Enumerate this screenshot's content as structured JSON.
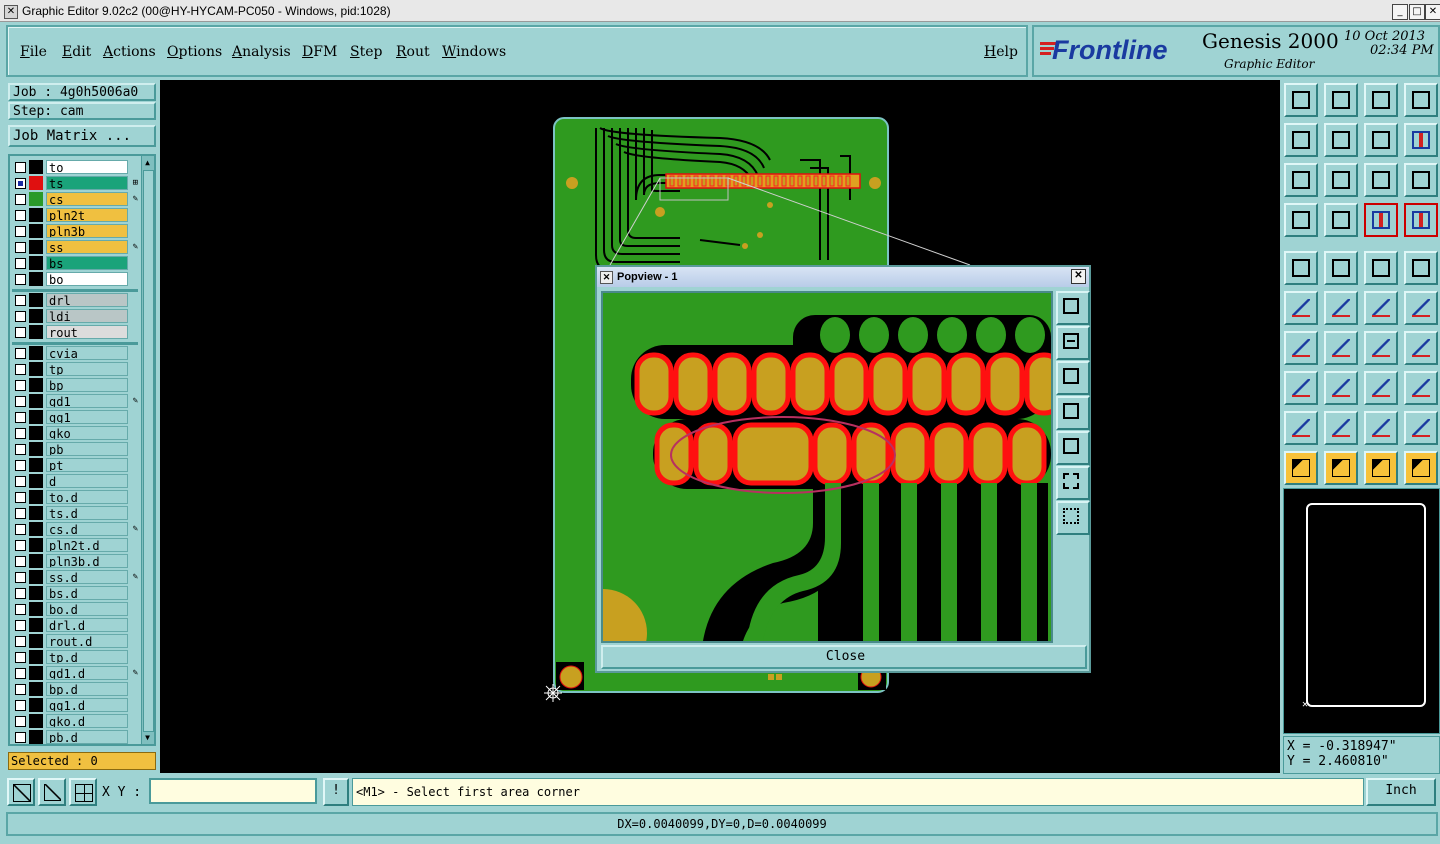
{
  "window": {
    "title": "Graphic Editor 9.02c2 (00@HY-HYCAM-PC050 - Windows, pid:1028)",
    "minimize": "_",
    "maximize": "□",
    "close": "✕"
  },
  "menu": {
    "items": [
      "File",
      "Edit",
      "Actions",
      "Options",
      "Analysis",
      "DFM",
      "Step",
      "Rout",
      "Windows"
    ],
    "help": "Help"
  },
  "brand": {
    "logo": "Frontline",
    "product": "Genesis 2000",
    "subtitle": "Graphic Editor",
    "date": "10 Oct 2013",
    "time": "02:34 PM"
  },
  "job": {
    "job_label": "Job : 4g0h5006a0",
    "step_label": "Step: cam",
    "matrix_button": "Job Matrix ..."
  },
  "layers": [
    {
      "name": "to",
      "bg": "#ffffff",
      "swatch": "#000000",
      "edit": ""
    },
    {
      "name": "ts",
      "bg": "#1aa37a",
      "swatch": "#e01010",
      "edit": "⊞",
      "selected": true
    },
    {
      "name": "cs",
      "bg": "#f0c040",
      "swatch": "#2a9a2a",
      "edit": "✎"
    },
    {
      "name": "pln2t",
      "bg": "#f0c040",
      "swatch": "#000000",
      "edit": ""
    },
    {
      "name": "pln3b",
      "bg": "#f0c040",
      "swatch": "#000000",
      "edit": ""
    },
    {
      "name": "ss",
      "bg": "#f0c040",
      "swatch": "#000000",
      "edit": "✎"
    },
    {
      "name": "bs",
      "bg": "#1aa37a",
      "swatch": "#000000",
      "edit": ""
    },
    {
      "name": "bo",
      "bg": "#ffffff",
      "swatch": "#000000",
      "edit": ""
    },
    {
      "name": "drl",
      "bg": "#b9c6c6",
      "swatch": "#000000",
      "edit": ""
    },
    {
      "name": "ldi",
      "bg": "#b9c6c6",
      "swatch": "#000000",
      "edit": ""
    },
    {
      "name": "rout",
      "bg": "#dcdcdc",
      "swatch": "#000000",
      "edit": ""
    },
    {
      "name": "cvia",
      "bg": "#9fd3d3",
      "swatch": "#000000",
      "edit": ""
    },
    {
      "name": "tp",
      "bg": "#9fd3d3",
      "swatch": "#000000",
      "edit": ""
    },
    {
      "name": "bp",
      "bg": "#9fd3d3",
      "swatch": "#000000",
      "edit": ""
    },
    {
      "name": "gd1",
      "bg": "#9fd3d3",
      "swatch": "#000000",
      "edit": "✎"
    },
    {
      "name": "gg1",
      "bg": "#9fd3d3",
      "swatch": "#000000",
      "edit": ""
    },
    {
      "name": "gko",
      "bg": "#9fd3d3",
      "swatch": "#000000",
      "edit": ""
    },
    {
      "name": "pb",
      "bg": "#9fd3d3",
      "swatch": "#000000",
      "edit": ""
    },
    {
      "name": "pt",
      "bg": "#9fd3d3",
      "swatch": "#000000",
      "edit": ""
    },
    {
      "name": "d",
      "bg": "#9fd3d3",
      "swatch": "#000000",
      "edit": ""
    },
    {
      "name": "to.d",
      "bg": "#9fd3d3",
      "swatch": "#000000",
      "edit": ""
    },
    {
      "name": "ts.d",
      "bg": "#9fd3d3",
      "swatch": "#000000",
      "edit": ""
    },
    {
      "name": "cs.d",
      "bg": "#9fd3d3",
      "swatch": "#000000",
      "edit": "✎"
    },
    {
      "name": "pln2t.d",
      "bg": "#9fd3d3",
      "swatch": "#000000",
      "edit": ""
    },
    {
      "name": "pln3b.d",
      "bg": "#9fd3d3",
      "swatch": "#000000",
      "edit": ""
    },
    {
      "name": "ss.d",
      "bg": "#9fd3d3",
      "swatch": "#000000",
      "edit": "✎"
    },
    {
      "name": "bs.d",
      "bg": "#9fd3d3",
      "swatch": "#000000",
      "edit": ""
    },
    {
      "name": "bo.d",
      "bg": "#9fd3d3",
      "swatch": "#000000",
      "edit": ""
    },
    {
      "name": "drl.d",
      "bg": "#9fd3d3",
      "swatch": "#000000",
      "edit": ""
    },
    {
      "name": "rout.d",
      "bg": "#9fd3d3",
      "swatch": "#000000",
      "edit": ""
    },
    {
      "name": "tp.d",
      "bg": "#9fd3d3",
      "swatch": "#000000",
      "edit": ""
    },
    {
      "name": "gd1.d",
      "bg": "#9fd3d3",
      "swatch": "#000000",
      "edit": "✎"
    },
    {
      "name": "bp.d",
      "bg": "#9fd3d3",
      "swatch": "#000000",
      "edit": ""
    },
    {
      "name": "gg1.d",
      "bg": "#9fd3d3",
      "swatch": "#000000",
      "edit": ""
    },
    {
      "name": "gko.d",
      "bg": "#9fd3d3",
      "swatch": "#000000",
      "edit": ""
    },
    {
      "name": "pb.d",
      "bg": "#9fd3d3",
      "swatch": "#000000",
      "edit": ""
    }
  ],
  "selected_label": "Selected : 0",
  "popup": {
    "title": "Popview - 1",
    "close_button": "Close",
    "close_x": "✕"
  },
  "coords": {
    "x": "X = -0.318947\"",
    "y": "Y = 2.460810\""
  },
  "cmd": {
    "xy_label": "X Y :",
    "xy_value": "",
    "prompt": "<M1> - Select first area corner",
    "units": "Inch",
    "bang": "!"
  },
  "status": {
    "text": "DX=0.0040099,DY=0,D=0.0040099"
  },
  "colors": {
    "panel": "#9fd3d3",
    "board_green": "#2f9a1f",
    "pad_gold": "#c8a020",
    "pad_outline": "#ff1010",
    "brand_red": "#d42020",
    "brand_blue": "#1a3aa0"
  },
  "toolbox_icons": [
    "zoom-home-icon",
    "zoom-out-icon",
    "home-view-icon",
    "split-view-icon",
    "pan-left-icon",
    "pan-right-icon",
    "undo-view-icon",
    "redo-view-icon",
    "zoom-fit-icon",
    "zoom-profile-icon",
    "scale-1-2-icon",
    "help-icon",
    "measure-tools-icon",
    "grid-icon",
    "snap-red-icon",
    "snap-grid-icon",
    "snap-center-icon",
    "snap-contour-icon",
    "ruler-icon",
    "snap-pad-icon",
    "connect-icon",
    "intersect-icon",
    "line-snap-icon",
    "point-snap-icon",
    "angle-icon",
    "line-select-icon",
    "arc-icon",
    "fiducial-icon",
    "rect-select-icon",
    "line-segment-icon",
    "distance-icon",
    "shapes-icon",
    "triangle-icon",
    "angle-outline-icon",
    "polygon-icon",
    "polygon-bar-icon",
    "select-arrow-icon",
    "select-arrow-box-icon",
    "select-arrow-circle-icon",
    "select-path-icon"
  ]
}
